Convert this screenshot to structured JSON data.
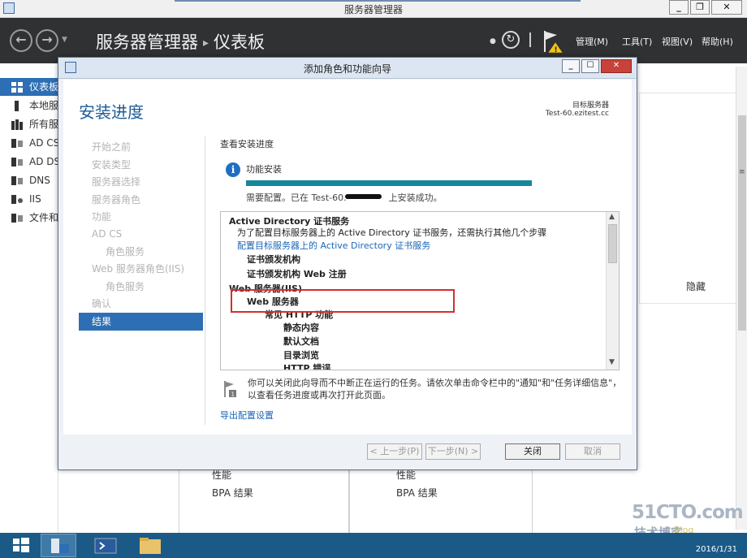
{
  "sm": {
    "window_title": "服务器管理器",
    "crumb_root": "服务器管理器",
    "crumb_page": "仪表板",
    "menu": [
      "管理(M)",
      "工具(T)",
      "视图(V)",
      "帮助(H)"
    ],
    "sidebar": [
      "仪表板",
      "本地服",
      "所有服",
      "AD CS",
      "AD DS",
      "DNS",
      "IIS",
      "文件和"
    ],
    "hide_label": "隐藏",
    "tile_labels": [
      "性能",
      "BPA 结果",
      "性能",
      "BPA 结果"
    ]
  },
  "wizard": {
    "title": "添加角色和功能向导",
    "heading": "安装进度",
    "target_title": "目标服务器",
    "target_name": "Test-60.ezitest.cc",
    "steps": [
      "开始之前",
      "安装类型",
      "服务器选择",
      "服务器角色",
      "功能",
      "AD CS",
      "角色服务",
      "Web 服务器角色(IIS)",
      "角色服务",
      "确认",
      "结果"
    ],
    "progress_label": "查看安装进度",
    "feature_install": "功能安装",
    "progress_value": 1.0,
    "status_text": "需要配置。已在 Test-60.",
    "status_suffix": "上安装成功。",
    "results": [
      "Active Directory 证书服务",
      "为了配置目标服务器上的 Active Directory 证书服务，还需执行其他几个步骤",
      "配置目标服务器上的 Active Directory 证书服务",
      "证书颁发机构",
      "证书颁发机构 Web 注册",
      "Web 服务器(IIS)",
      "Web 服务器",
      "常见 HTTP 功能",
      "静态内容",
      "默认文档",
      "目录浏览",
      "HTTP 错误"
    ],
    "note": "你可以关闭此向导而不中断正在运行的任务。请依次单击命令栏中的\"通知\"和\"任务详细信息\"，以查看任务进度或再次打开此页面。",
    "export_link": "导出配置设置",
    "buttons": {
      "prev": "< 上一步(P)",
      "next": "下一步(N) >",
      "close": "关闭",
      "cancel": "取消"
    }
  },
  "taskbar": {
    "date": "2016/1/31"
  },
  "watermark": {
    "line1": "51CTO.com",
    "line2": "技术博客",
    "line3": "Blog"
  },
  "colors": {
    "accent": "#2d6eb4",
    "progress": "#16879b",
    "highlight": "#d62e2e",
    "header_bg": "#2f3133",
    "taskbar_bg": "#1b5a87"
  }
}
